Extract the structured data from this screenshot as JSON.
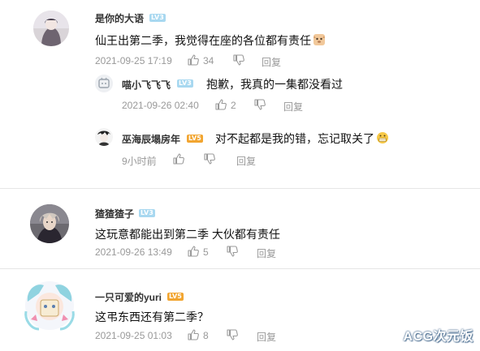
{
  "comments": [
    {
      "user": "是你的大语",
      "level": "LV3",
      "text": "仙王出第二季，我觉得在座的各位都有责任",
      "emoji": "dog-emoji",
      "time": "2021-09-25 17:19",
      "likes": "34",
      "reply_label": "回复",
      "replies": [
        {
          "user": "喵小飞飞飞",
          "level": "LV3",
          "text": "抱歉，我真的一集都没看过",
          "time": "2021-09-26 02:40",
          "likes": "2",
          "reply_label": "回复"
        },
        {
          "user": "巫海辰塌房年",
          "level": "LV5",
          "text": "对不起都是我的错，忘记取关了",
          "emoji": "grimace-emoji",
          "time": "9小时前",
          "reply_label": "回复"
        }
      ]
    },
    {
      "user": "猹猹猹子",
      "level": "LV3",
      "text": "这玩意都能出到第二季 大伙都有责任",
      "time": "2021-09-26 13:49",
      "likes": "5",
      "reply_label": "回复"
    },
    {
      "user": "一只可爱的yuri",
      "level": "LV5",
      "text": "这弔东西还有第二季？",
      "time": "2021-09-25 01:03",
      "likes": "8",
      "reply_label": "回复"
    }
  ],
  "watermark": "ACG次元饭",
  "colors": {
    "meta": "#999999",
    "badge_blue": "#a8d8f0",
    "badge_orange": "#f2a530",
    "divider": "#e6e6e6"
  }
}
